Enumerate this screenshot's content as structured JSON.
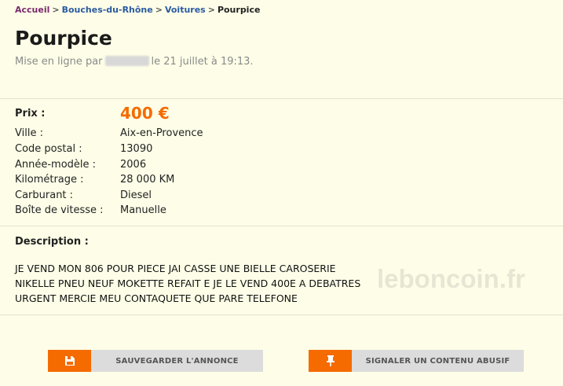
{
  "breadcrumb": {
    "home": "Accueil",
    "region": "Bouches-du-Rhône",
    "category": "Voitures",
    "current": "Pourpice",
    "separator": ">"
  },
  "ad": {
    "title": "Pourpice",
    "posted_prefix": "Mise en ligne par",
    "posted_suffix": "le 21 juillet à 19:13."
  },
  "specs": {
    "price_label": "Prix :",
    "price_value": "400 €",
    "rows": [
      {
        "label": "Ville :",
        "value": "Aix-en-Provence"
      },
      {
        "label": "Code postal :",
        "value": "13090"
      },
      {
        "label": "Année-modèle :",
        "value": "2006"
      },
      {
        "label": "Kilométrage :",
        "value": "28 000 KM"
      },
      {
        "label": "Carburant :",
        "value": "Diesel"
      },
      {
        "label": "Boîte de vitesse :",
        "value": "Manuelle"
      }
    ]
  },
  "description": {
    "title": "Description :",
    "text": "JE VEND MON 806 POUR PIECE JAI CASSE UNE BIELLE CAROSERIE\nNIKELLE PNEU NEUF MOKETTE REFAIT E JE LE VEND 400E A DEBATRES\nURGENT MERCIE MEU CONTAQUETE QUE PARE TELEFONE",
    "watermark": "leboncoin.fr"
  },
  "actions": {
    "save_label": "SAUVEGARDER L'ANNONCE",
    "save_icon": "save-icon",
    "report_label": "SIGNALER UN CONTENU ABUSIF",
    "report_icon": "pin-icon"
  },
  "colors": {
    "accent": "#f56b00",
    "background": "#fefee8",
    "link": "#2a5aa0",
    "home_link": "#7a2a6e"
  }
}
